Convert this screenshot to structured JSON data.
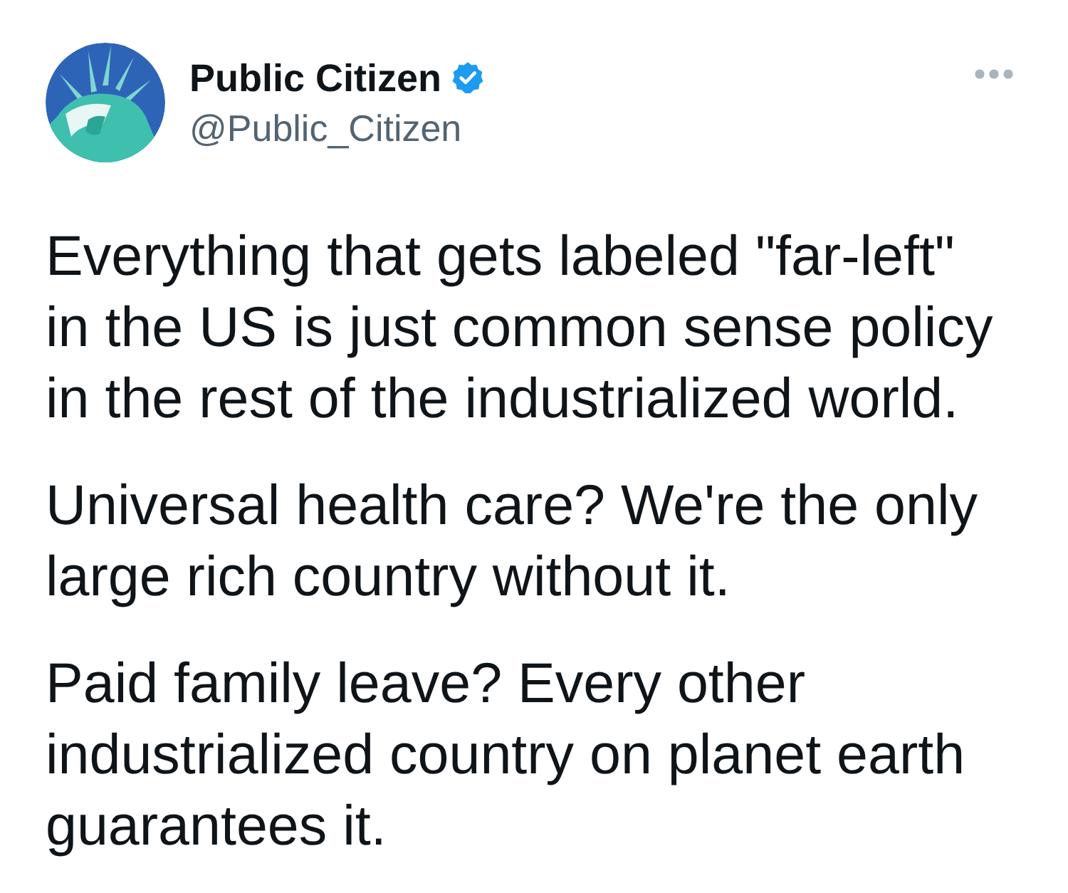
{
  "author": {
    "name": "Public Citizen",
    "verified": true,
    "handle": "@Public_Citizen"
  },
  "tweet": {
    "paragraphs": [
      "Everything that gets labeled \"far-left\" in the US is just common sense policy in the rest of the industrialized world.",
      "Universal health care? We're the only large rich country without it.",
      "Paid family leave? Every other industrialized country on planet earth guarantees it."
    ]
  }
}
